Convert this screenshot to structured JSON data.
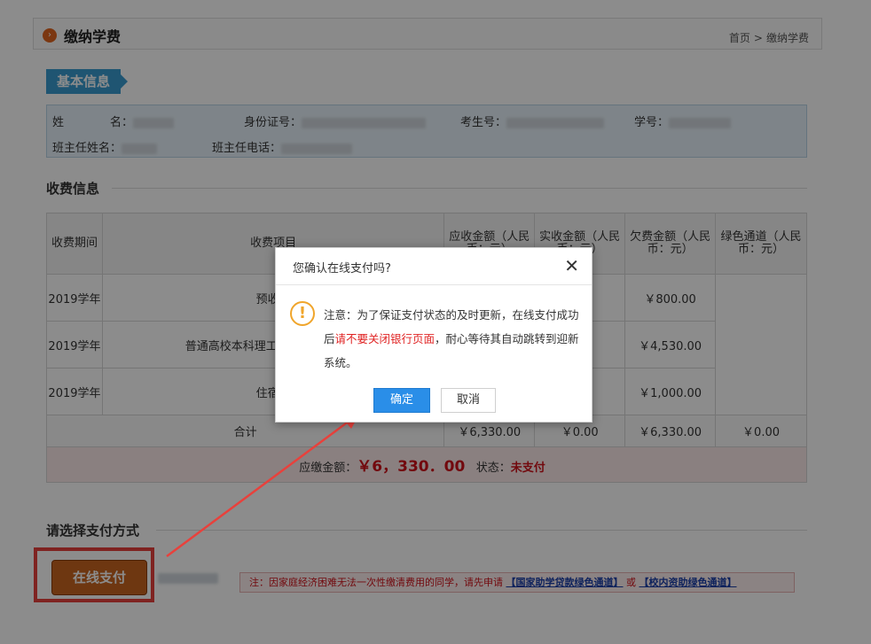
{
  "page": {
    "title": "缴纳学费",
    "breadcrumb": [
      "首页",
      ">",
      "缴纳学费"
    ]
  },
  "basic_info": {
    "tag": "基本信息",
    "labels": {
      "name": "姓　　　　名：",
      "id_card": "身份证号：",
      "exam_no": "考生号：",
      "student_no": "学号：",
      "teacher_name": "班主任姓名：",
      "teacher_phone": "班主任电话："
    }
  },
  "fees": {
    "section_title": "收费信息",
    "headers": [
      "收费期间",
      "收费项目",
      "应收金额（人民币：元）",
      "实收金额（人民币：元）",
      "欠费金额（人民币：元）",
      "绿色通道（人民币：元）"
    ],
    "rows": [
      {
        "period": "2019学年",
        "item": "预收费",
        "owed": "￥800.00"
      },
      {
        "period": "2019学年",
        "item": "普通高校本科理工（Ⅰ）类专业高校",
        "owed": "￥4,530.00"
      },
      {
        "period": "2019学年",
        "item": "住宿费",
        "owed": "￥1,000.00"
      }
    ],
    "total": {
      "label": "合计",
      "receivable": "￥6,330.00",
      "received": "￥0.00",
      "owed": "￥6,330.00",
      "green": "￥0.00"
    },
    "due_label": "应缴金额：",
    "due_amount": "￥6，330．00",
    "status_label": "状态：",
    "status_value": "未支付"
  },
  "payment": {
    "section_title": "请选择支付方式",
    "online_pay": "在线支付",
    "note_prefix": "注：因家庭经济困难无法一次性缴清费用的同学，请先申请",
    "link1": "【国家助学贷款绿色通道】",
    "or": "或",
    "link2": "【校内资助绿色通道】"
  },
  "dialog": {
    "title": "您确认在线支付吗?",
    "close": "✕",
    "msg_part1": "注意：为了保证支付状态的及时更新，在线支付成功后",
    "msg_red": "请不要关闭银行页面",
    "msg_part2": "，耐心等待其自动跳转到迎新系统。",
    "ok": "确定",
    "cancel": "取消"
  },
  "colors": {
    "accent": "#2a8ee8",
    "warning": "#f0a52b",
    "alert": "#e02424",
    "pay_button": "#c8641f"
  }
}
